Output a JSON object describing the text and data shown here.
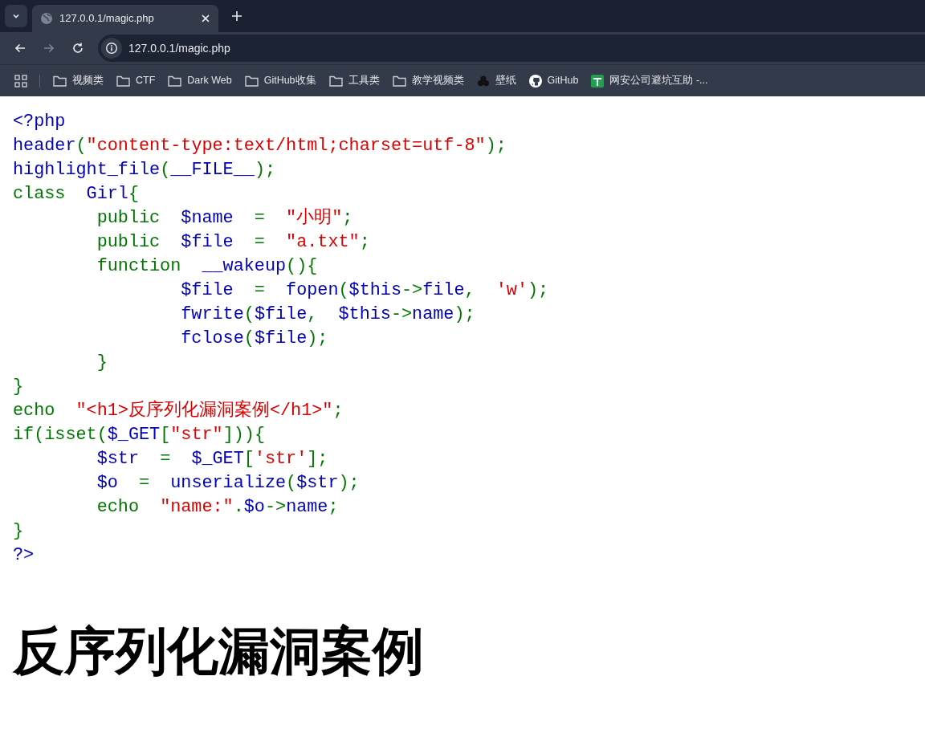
{
  "browser": {
    "tab": {
      "title": "127.0.0.1/magic.php",
      "selected": true
    },
    "nav": [
      {
        "kind": "back",
        "disabled": false
      },
      {
        "kind": "forward",
        "disabled": true
      },
      {
        "kind": "reload",
        "disabled": false
      }
    ],
    "address": "127.0.0.1/magic.php",
    "bookmarks": [
      {
        "label": "视频类",
        "kind": "folder"
      },
      {
        "label": "CTF",
        "kind": "folder"
      },
      {
        "label": "Dark Web",
        "kind": "folder"
      },
      {
        "label": "GitHub收集",
        "kind": "folder"
      },
      {
        "label": "工具类",
        "kind": "folder"
      },
      {
        "label": "教学视频类",
        "kind": "folder"
      },
      {
        "label": "壁纸",
        "kind": "clover"
      },
      {
        "label": "GitHub",
        "kind": "github"
      },
      {
        "label": "网安公司避坑互助 -...",
        "kind": "sheet"
      }
    ]
  },
  "code_lines": [
    [
      {
        "kind": "default",
        "text": "<?php"
      }
    ],
    [
      {
        "kind": "default",
        "text": "header"
      },
      {
        "kind": "keyword",
        "text": "("
      },
      {
        "kind": "string",
        "text": "\"content-type:text/html;charset=utf-8\""
      },
      {
        "kind": "keyword",
        "text": ");"
      }
    ],
    [
      {
        "kind": "default",
        "text": "highlight_file"
      },
      {
        "kind": "keyword",
        "text": "("
      },
      {
        "kind": "default",
        "text": "__FILE__"
      },
      {
        "kind": "keyword",
        "text": ");"
      }
    ],
    [
      {
        "kind": "keyword",
        "text": "class  "
      },
      {
        "kind": "default",
        "text": "Girl"
      },
      {
        "kind": "keyword",
        "text": "{"
      }
    ],
    [
      {
        "kind": "keyword",
        "text": "        public  "
      },
      {
        "kind": "default",
        "text": "$name  "
      },
      {
        "kind": "keyword",
        "text": "=  "
      },
      {
        "kind": "string",
        "text": "\"小明\""
      },
      {
        "kind": "keyword",
        "text": ";"
      }
    ],
    [
      {
        "kind": "keyword",
        "text": "        public  "
      },
      {
        "kind": "default",
        "text": "$file  "
      },
      {
        "kind": "keyword",
        "text": "=  "
      },
      {
        "kind": "string",
        "text": "\"a.txt\""
      },
      {
        "kind": "keyword",
        "text": ";"
      }
    ],
    [
      {
        "kind": "keyword",
        "text": "        function  "
      },
      {
        "kind": "default",
        "text": "__wakeup"
      },
      {
        "kind": "keyword",
        "text": "(){"
      }
    ],
    [
      {
        "kind": "default",
        "text": "                $file  "
      },
      {
        "kind": "keyword",
        "text": "=  "
      },
      {
        "kind": "default",
        "text": "fopen"
      },
      {
        "kind": "keyword",
        "text": "("
      },
      {
        "kind": "default",
        "text": "$this"
      },
      {
        "kind": "keyword",
        "text": "->"
      },
      {
        "kind": "default",
        "text": "file"
      },
      {
        "kind": "keyword",
        "text": ",  "
      },
      {
        "kind": "string",
        "text": "'w'"
      },
      {
        "kind": "keyword",
        "text": ");"
      }
    ],
    [
      {
        "kind": "default",
        "text": "                fwrite"
      },
      {
        "kind": "keyword",
        "text": "("
      },
      {
        "kind": "default",
        "text": "$file"
      },
      {
        "kind": "keyword",
        "text": ",  "
      },
      {
        "kind": "default",
        "text": "$this"
      },
      {
        "kind": "keyword",
        "text": "->"
      },
      {
        "kind": "default",
        "text": "name"
      },
      {
        "kind": "keyword",
        "text": ");"
      }
    ],
    [
      {
        "kind": "default",
        "text": "                fclose"
      },
      {
        "kind": "keyword",
        "text": "("
      },
      {
        "kind": "default",
        "text": "$file"
      },
      {
        "kind": "keyword",
        "text": ");"
      }
    ],
    [
      {
        "kind": "keyword",
        "text": "        }"
      }
    ],
    [
      {
        "kind": "keyword",
        "text": "}"
      }
    ],
    [
      {
        "kind": "keyword",
        "text": "echo  "
      },
      {
        "kind": "string",
        "text": "\"<h1>反序列化漏洞案例</h1>\""
      },
      {
        "kind": "keyword",
        "text": ";"
      }
    ],
    [
      {
        "kind": "keyword",
        "text": "if(isset("
      },
      {
        "kind": "default",
        "text": "$_GET"
      },
      {
        "kind": "keyword",
        "text": "["
      },
      {
        "kind": "string",
        "text": "\"str\""
      },
      {
        "kind": "keyword",
        "text": "])){"
      }
    ],
    [
      {
        "kind": "default",
        "text": "        $str  "
      },
      {
        "kind": "keyword",
        "text": "=  "
      },
      {
        "kind": "default",
        "text": "$_GET"
      },
      {
        "kind": "keyword",
        "text": "["
      },
      {
        "kind": "string",
        "text": "'str'"
      },
      {
        "kind": "keyword",
        "text": "];"
      }
    ],
    [
      {
        "kind": "default",
        "text": "        $o  "
      },
      {
        "kind": "keyword",
        "text": "=  "
      },
      {
        "kind": "default",
        "text": "unserialize"
      },
      {
        "kind": "keyword",
        "text": "("
      },
      {
        "kind": "default",
        "text": "$str"
      },
      {
        "kind": "keyword",
        "text": ");"
      }
    ],
    [
      {
        "kind": "keyword",
        "text": "        echo  "
      },
      {
        "kind": "string",
        "text": "\"name:\""
      },
      {
        "kind": "keyword",
        "text": "."
      },
      {
        "kind": "default",
        "text": "$o"
      },
      {
        "kind": "keyword",
        "text": "->"
      },
      {
        "kind": "default",
        "text": "name"
      },
      {
        "kind": "keyword",
        "text": ";"
      }
    ],
    [
      {
        "kind": "keyword",
        "text": "}"
      }
    ],
    [
      {
        "kind": "default",
        "text": "?>"
      }
    ]
  ],
  "heading": "反序列化漏洞案例"
}
